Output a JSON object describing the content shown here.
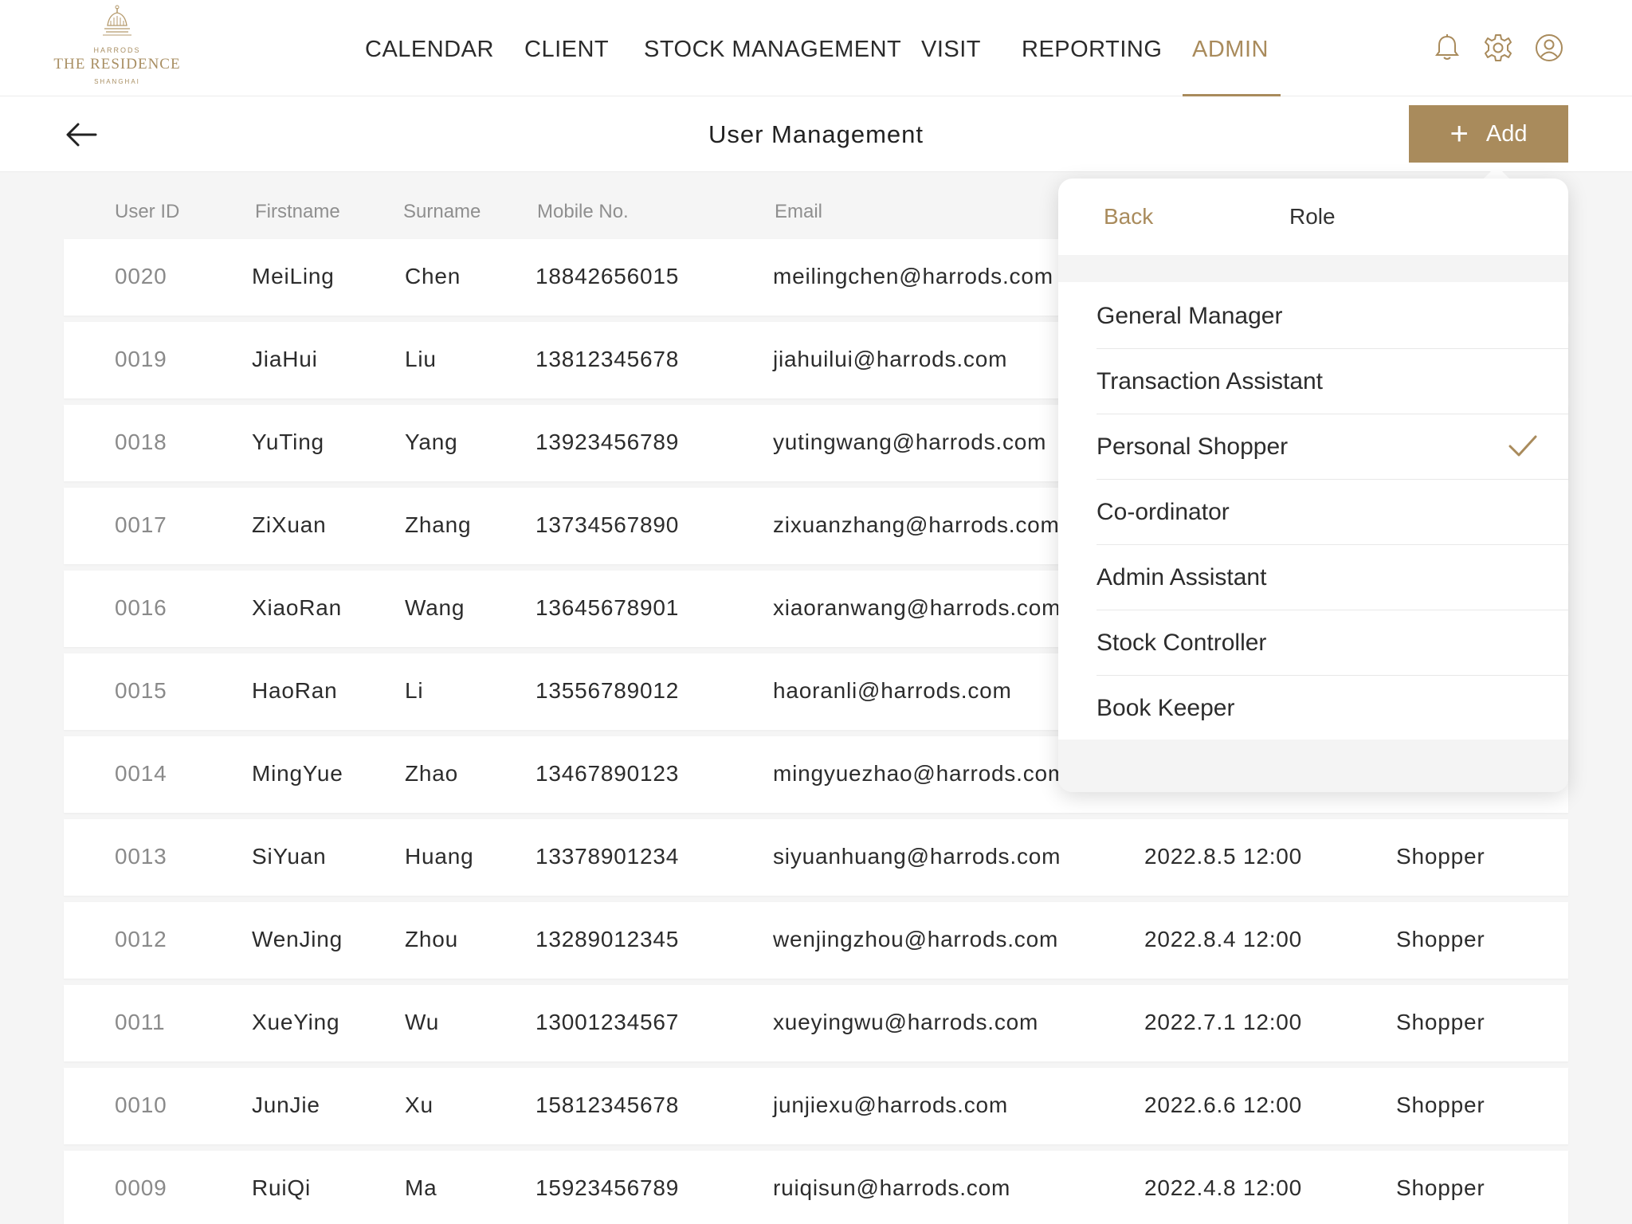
{
  "logo": {
    "top_line": "HARRODS",
    "name": "THE RESIDENCE",
    "city": "SHANGHAI"
  },
  "nav": {
    "items": [
      {
        "label": "CALENDAR",
        "active": false
      },
      {
        "label": "CLIENT",
        "active": false
      },
      {
        "label": "STOCK MANAGEMENT",
        "active": false
      },
      {
        "label": "VISIT",
        "active": false
      },
      {
        "label": "REPORTING",
        "active": false
      },
      {
        "label": "ADMIN",
        "active": true
      }
    ]
  },
  "icons": {
    "notifications": "bell-icon",
    "settings": "gear-icon",
    "profile": "user-circle-icon",
    "back": "arrow-left-icon",
    "selected": "checkmark-icon"
  },
  "header": {
    "title": "User Management",
    "add_label": "Add"
  },
  "table": {
    "columns": [
      "User ID",
      "Firstname",
      "Surname",
      "Mobile No.",
      "Email"
    ],
    "rows": [
      {
        "id": "0020",
        "first": "MeiLing",
        "last": "Chen",
        "mobile": "18842656015",
        "email": "meilingchen@harrods.com",
        "date": "",
        "role": ""
      },
      {
        "id": "0019",
        "first": "JiaHui",
        "last": "Liu",
        "mobile": "13812345678",
        "email": "jiahuilui@harrods.com",
        "date": "",
        "role": ""
      },
      {
        "id": "0018",
        "first": "YuTing",
        "last": "Yang",
        "mobile": "13923456789",
        "email": "yutingwang@harrods.com",
        "date": "",
        "role": ""
      },
      {
        "id": "0017",
        "first": "ZiXuan",
        "last": "Zhang",
        "mobile": "13734567890",
        "email": "zixuanzhang@harrods.com",
        "date": "",
        "role": ""
      },
      {
        "id": "0016",
        "first": "XiaoRan",
        "last": "Wang",
        "mobile": "13645678901",
        "email": "xiaoranwang@harrods.com",
        "date": "",
        "role": ""
      },
      {
        "id": "0015",
        "first": "HaoRan",
        "last": "Li",
        "mobile": "13556789012",
        "email": "haoranli@harrods.com",
        "date": "",
        "role": ""
      },
      {
        "id": "0014",
        "first": "MingYue",
        "last": "Zhao",
        "mobile": "13467890123",
        "email": "mingyuezhao@harrods.com",
        "date": "",
        "role": ""
      },
      {
        "id": "0013",
        "first": "SiYuan",
        "last": "Huang",
        "mobile": "13378901234",
        "email": "siyuanhuang@harrods.com",
        "date": "2022.8.5 12:00",
        "role": "Shopper"
      },
      {
        "id": "0012",
        "first": "WenJing",
        "last": "Zhou",
        "mobile": "13289012345",
        "email": "wenjingzhou@harrods.com",
        "date": "2022.8.4 12:00",
        "role": "Shopper"
      },
      {
        "id": "0011",
        "first": "XueYing",
        "last": "Wu",
        "mobile": "13001234567",
        "email": "xueyingwu@harrods.com",
        "date": "2022.7.1 12:00",
        "role": "Shopper"
      },
      {
        "id": "0010",
        "first": "JunJie",
        "last": "Xu",
        "mobile": "15812345678",
        "email": "junjiexu@harrods.com",
        "date": "2022.6.6 12:00",
        "role": "Shopper"
      },
      {
        "id": "0009",
        "first": "RuiQi",
        "last": "Ma",
        "mobile": "15923456789",
        "email": "ruiqisun@harrods.com",
        "date": "2022.4.8 12:00",
        "role": "Shopper"
      }
    ]
  },
  "role_menu": {
    "back_label": "Back",
    "title": "Role",
    "options": [
      {
        "label": "General Manager",
        "selected": false
      },
      {
        "label": "Transaction Assistant",
        "selected": false
      },
      {
        "label": "Personal Shopper",
        "selected": true
      },
      {
        "label": "Co-ordinator",
        "selected": false
      },
      {
        "label": "Admin Assistant",
        "selected": false
      },
      {
        "label": "Stock Controller",
        "selected": false
      },
      {
        "label": "Book Keeper",
        "selected": false
      }
    ]
  },
  "colors": {
    "accent": "#a98b5c",
    "background": "#f5f5f5",
    "surface": "#ffffff"
  }
}
